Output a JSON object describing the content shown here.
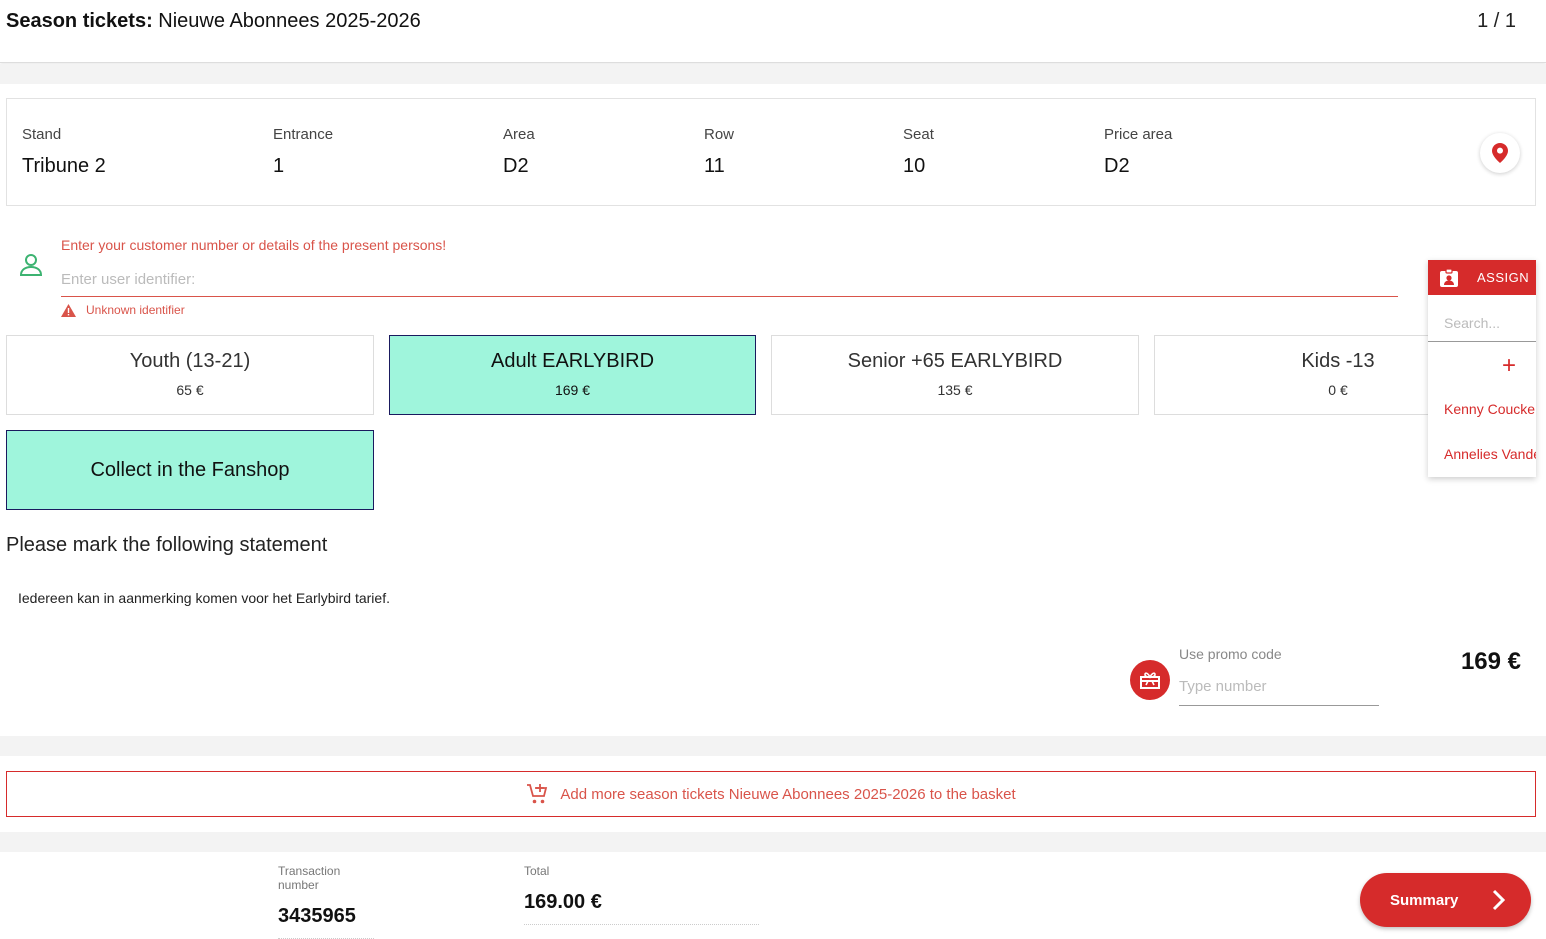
{
  "header": {
    "title_bold": "Season tickets:",
    "title": "Nieuwe Abonnees 2025-2026",
    "pager": "1 / 1"
  },
  "seat": [
    {
      "label": "Stand",
      "value": "Tribune 2"
    },
    {
      "label": "Entrance",
      "value": "1"
    },
    {
      "label": "Area",
      "value": "D2"
    },
    {
      "label": "Row",
      "value": "11"
    },
    {
      "label": "Seat",
      "value": "10"
    },
    {
      "label": "Price area",
      "value": "D2"
    }
  ],
  "user": {
    "hint": "Enter your customer number or details of the present persons!",
    "placeholder": "Enter user identifier:",
    "error": "Unknown identifier"
  },
  "tariffs": [
    {
      "name": "Youth (13-21)",
      "price": "65 €",
      "selected": false
    },
    {
      "name": "Adult EARLYBIRD",
      "price": "169 €",
      "selected": true
    },
    {
      "name": "Senior +65 EARLYBIRD",
      "price": "135 €",
      "selected": false
    },
    {
      "name": "Kids -13",
      "price": "0 €",
      "selected": false
    }
  ],
  "delivery": {
    "label": "Collect in the Fanshop"
  },
  "statement": {
    "heading": "Please mark the following statement",
    "text": "Iedereen kan in aanmerking komen voor het Earlybird tarief."
  },
  "promo": {
    "label": "Use promo code",
    "placeholder": "Type number"
  },
  "price": "169 €",
  "basket": {
    "label": "Add more season tickets Nieuwe Abonnees 2025-2026 to the basket"
  },
  "footer": {
    "transaction_label": "Transaction number",
    "transaction_value": "3435965",
    "total_label": "Total",
    "total_value": "169.00 €",
    "summary_label": "Summary"
  },
  "assign": {
    "button_label": "ASSIGN",
    "search_placeholder": "Search...",
    "add_symbol": "+",
    "persons": [
      "Kenny Coucke",
      "Annelies Vande"
    ]
  },
  "colors": {
    "accent": "#d62b2b",
    "selected_tile": "#9ff5dc",
    "error": "#d9544a",
    "user_icon": "#3cb371"
  }
}
